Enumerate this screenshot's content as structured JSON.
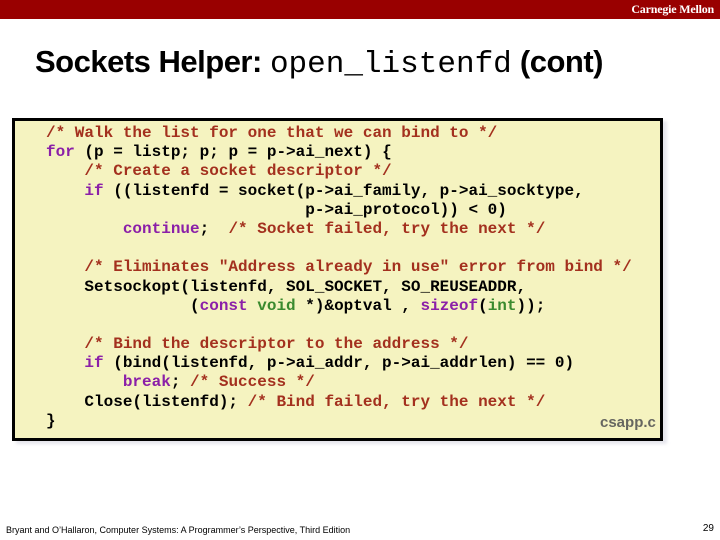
{
  "header": {
    "brand": "Carnegie Mellon",
    "bar_color": "#990000"
  },
  "slide": {
    "title_prefix": "Sockets Helper: ",
    "title_code": "open_listenfd",
    "title_suffix": " (cont)"
  },
  "code": {
    "filename": "csapp.c",
    "lines": [
      [
        {
          "t": "cm",
          "s": "/* Walk the list for one that we can bind to */"
        }
      ],
      [
        {
          "t": "kw",
          "s": "for"
        },
        {
          "t": "",
          "s": " (p = listp; p; p = p->ai_next) {"
        }
      ],
      [
        {
          "t": "",
          "s": "    "
        },
        {
          "t": "cm",
          "s": "/* Create a socket descriptor */"
        }
      ],
      [
        {
          "t": "",
          "s": "    "
        },
        {
          "t": "kw",
          "s": "if"
        },
        {
          "t": "",
          "s": " ((listenfd = socket(p->ai_family, p->ai_socktype,"
        }
      ],
      [
        {
          "t": "",
          "s": "                           p->ai_protocol)) < 0)"
        }
      ],
      [
        {
          "t": "",
          "s": "        "
        },
        {
          "t": "kw",
          "s": "continue"
        },
        {
          "t": "",
          "s": ";  "
        },
        {
          "t": "cm",
          "s": "/* Socket failed, try the next */"
        }
      ],
      [
        {
          "t": "",
          "s": ""
        }
      ],
      [
        {
          "t": "",
          "s": "    "
        },
        {
          "t": "cm",
          "s": "/* Eliminates \"Address already in use\" error from bind */"
        }
      ],
      [
        {
          "t": "",
          "s": "    Setsockopt(listenfd, SOL_SOCKET, SO_REUSEADDR,"
        }
      ],
      [
        {
          "t": "",
          "s": "               ("
        },
        {
          "t": "kw",
          "s": "const"
        },
        {
          "t": "",
          "s": " "
        },
        {
          "t": "ty",
          "s": "void"
        },
        {
          "t": "",
          "s": " *)&optval , "
        },
        {
          "t": "kw",
          "s": "sizeof"
        },
        {
          "t": "",
          "s": "("
        },
        {
          "t": "ty",
          "s": "int"
        },
        {
          "t": "",
          "s": "));"
        }
      ],
      [
        {
          "t": "",
          "s": ""
        }
      ],
      [
        {
          "t": "",
          "s": "    "
        },
        {
          "t": "cm",
          "s": "/* Bind the descriptor to the address */"
        }
      ],
      [
        {
          "t": "",
          "s": "    "
        },
        {
          "t": "kw",
          "s": "if"
        },
        {
          "t": "",
          "s": " (bind(listenfd, p->ai_addr, p->ai_addrlen) == 0)"
        }
      ],
      [
        {
          "t": "",
          "s": "        "
        },
        {
          "t": "kw",
          "s": "break"
        },
        {
          "t": "",
          "s": "; "
        },
        {
          "t": "cm",
          "s": "/* Success */"
        }
      ],
      [
        {
          "t": "",
          "s": "    Close(listenfd); "
        },
        {
          "t": "cm",
          "s": "/* Bind failed, try the next */"
        }
      ],
      [
        {
          "t": "",
          "s": "}"
        }
      ]
    ]
  },
  "footer": {
    "citation": "Bryant and O’Hallaron, Computer Systems: A Programmer’s Perspective, Third Edition",
    "page_number": "29"
  }
}
